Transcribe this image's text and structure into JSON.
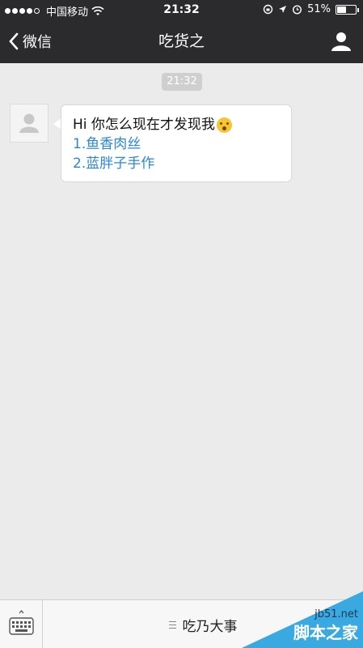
{
  "status_bar": {
    "carrier": "中国移动",
    "time": "21:32",
    "battery": "51%",
    "battery_level": 0.51
  },
  "nav": {
    "back_label": "微信",
    "title": "吃货之"
  },
  "chat": {
    "timestamp": "21:32",
    "message": {
      "text": "Hi 你怎么现在才发现我",
      "links": [
        "1.鱼香肉丝",
        "2.蓝胖子手作"
      ]
    }
  },
  "bottom_menu": {
    "item_label": "吃乃大事"
  },
  "watermark": {
    "site": "jb51.net",
    "name": "脚本之家"
  },
  "colors": {
    "nav_bg": "#2b2b2d",
    "chat_bg": "#ebebeb",
    "link": "#2b86d9"
  }
}
